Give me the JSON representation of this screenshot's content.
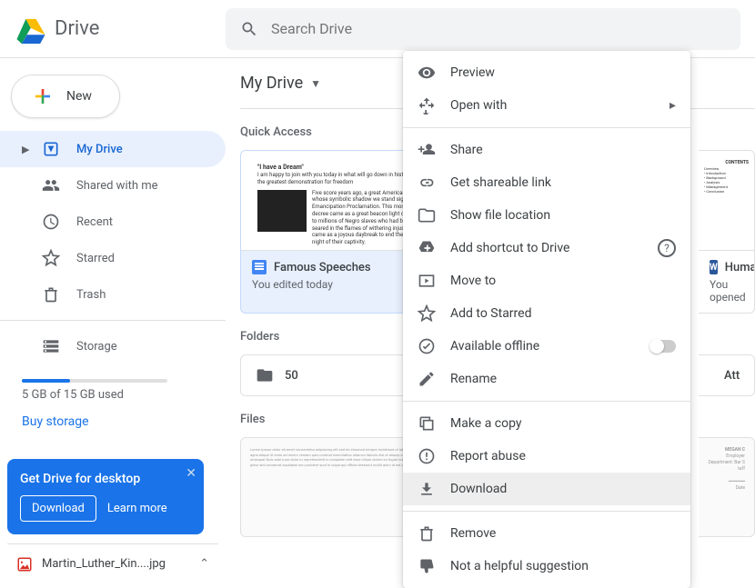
{
  "header": {
    "app_name": "Drive",
    "search_placeholder": "Search Drive"
  },
  "sidebar": {
    "new_label": "New",
    "items": [
      {
        "label": "My Drive",
        "icon": "drive-icon",
        "active": true
      },
      {
        "label": "Shared with me",
        "icon": "people-icon"
      },
      {
        "label": "Recent",
        "icon": "clock-icon"
      },
      {
        "label": "Starred",
        "icon": "star-icon"
      },
      {
        "label": "Trash",
        "icon": "trash-icon"
      }
    ],
    "storage_label": "Storage",
    "storage_used": "5 GB of 15 GB used",
    "storage_fill_pct": 33,
    "buy_label": "Buy storage"
  },
  "promo": {
    "title": "Get Drive for desktop",
    "download": "Download",
    "learn": "Learn more"
  },
  "download_bar": {
    "file": "Martin_Luther_Kin....jpg"
  },
  "main": {
    "breadcrumb": "My Drive",
    "quick_access_title": "Quick Access",
    "qa_cards": [
      {
        "name": "Famous Speeches",
        "sub": "You edited today",
        "thumb_title": "\"I have a Dream\""
      },
      {
        "name": "Huma",
        "sub": "You opened",
        "thumb_title": "CONTENTS"
      }
    ],
    "folders_title": "Folders",
    "folders": [
      {
        "name": "50"
      },
      {
        "name": "Att"
      }
    ],
    "files_title": "Files"
  },
  "context_menu": {
    "groups": [
      [
        {
          "label": "Preview",
          "icon": "eye-icon"
        },
        {
          "label": "Open with",
          "icon": "openwith-icon",
          "chevron": true
        }
      ],
      [
        {
          "label": "Share",
          "icon": "person-add-icon"
        },
        {
          "label": "Get shareable link",
          "icon": "link-icon"
        },
        {
          "label": "Show file location",
          "icon": "folder-icon"
        },
        {
          "label": "Add shortcut to Drive",
          "icon": "drive-add-icon",
          "help": true
        },
        {
          "label": "Move to",
          "icon": "move-icon"
        },
        {
          "label": "Add to Starred",
          "icon": "star-icon"
        },
        {
          "label": "Available offline",
          "icon": "offline-icon",
          "toggle": true
        },
        {
          "label": "Rename",
          "icon": "pencil-icon"
        }
      ],
      [
        {
          "label": "Make a copy",
          "icon": "copy-icon"
        },
        {
          "label": "Report abuse",
          "icon": "report-icon"
        },
        {
          "label": "Download",
          "icon": "download-icon",
          "highlight": true
        }
      ],
      [
        {
          "label": "Remove",
          "icon": "trash-icon"
        },
        {
          "label": "Not a helpful suggestion",
          "icon": "thumb-down-icon"
        }
      ]
    ]
  }
}
